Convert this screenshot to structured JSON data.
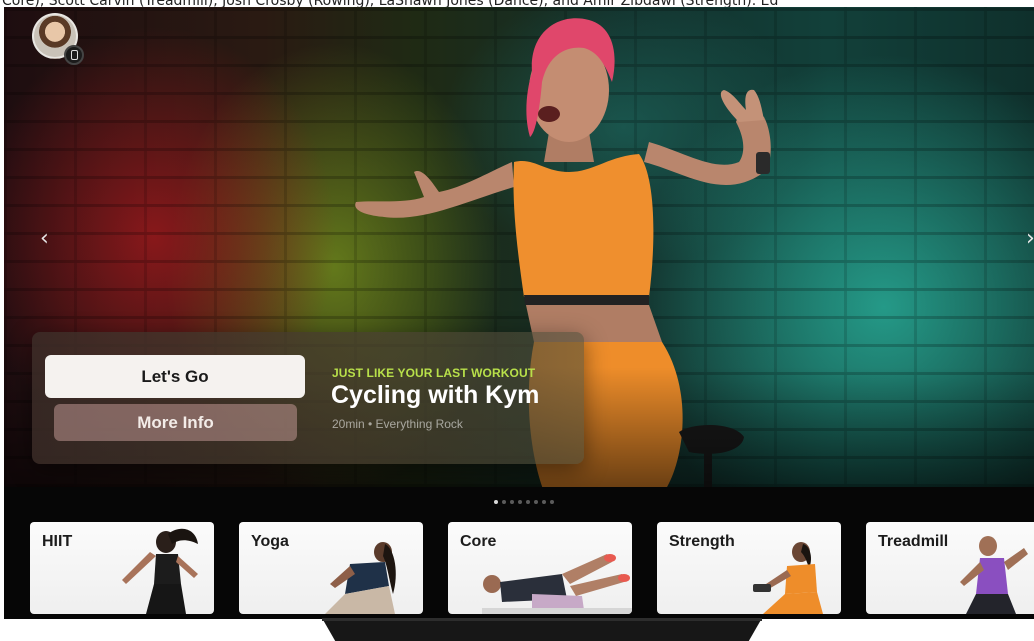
{
  "caption": {
    "text": "Core), Scott Carvin (Treadmill), Josh Crosby (Rowing), LaShawn Jones (Dance), and Amir Zibdawi (Strength). Ed"
  },
  "profile": {
    "icon": "avatar-icon",
    "badge_icon": "watch-icon"
  },
  "nav": {
    "prev_glyph": "‹",
    "next_glyph": "›"
  },
  "hero": {
    "eyebrow": "JUST LIKE YOUR LAST WORKOUT",
    "title": "Cycling with Kym",
    "meta": "20min • Everything Rock",
    "primary_button": "Let's Go",
    "secondary_button": "More Info",
    "eyebrow_color": "#b8e04a"
  },
  "pagination": {
    "total": 8,
    "active_index": 0
  },
  "categories": [
    {
      "label": "HIIT"
    },
    {
      "label": "Yoga"
    },
    {
      "label": "Core"
    },
    {
      "label": "Strength"
    },
    {
      "label": "Treadmill"
    }
  ]
}
